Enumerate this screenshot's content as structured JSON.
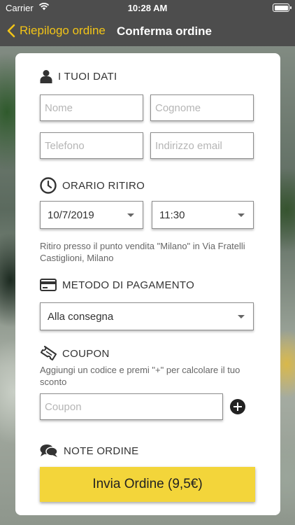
{
  "status_bar": {
    "carrier": "Carrier",
    "time": "10:28 AM"
  },
  "nav": {
    "back_label": "Riepilogo ordine",
    "title": "Conferma ordine"
  },
  "sections": {
    "personal": {
      "title": "I TUOI DATI",
      "name_placeholder": "Nome",
      "surname_placeholder": "Cognome",
      "phone_placeholder": "Telefono",
      "email_placeholder": "Indirizzo email"
    },
    "pickup": {
      "title": "ORARIO RITIRO",
      "date_value": "10/7/2019",
      "time_value": "11:30",
      "info": "Ritiro presso il punto vendita \"Milano\" in Via Fratelli Castiglioni, Milano"
    },
    "payment": {
      "title": "METODO DI PAGAMENTO",
      "method_value": "Alla consegna"
    },
    "coupon": {
      "title": "COUPON",
      "info": "Aggiungi un codice e premi \"+\" per calcolare il tuo sconto",
      "placeholder": "Coupon"
    },
    "notes": {
      "title": "NOTE ORDINE"
    }
  },
  "submit_label": "Invia Ordine (9,5€)",
  "colors": {
    "accent": "#f2c417",
    "button": "#f3d53a",
    "nav_bg": "#4d4d4d"
  }
}
